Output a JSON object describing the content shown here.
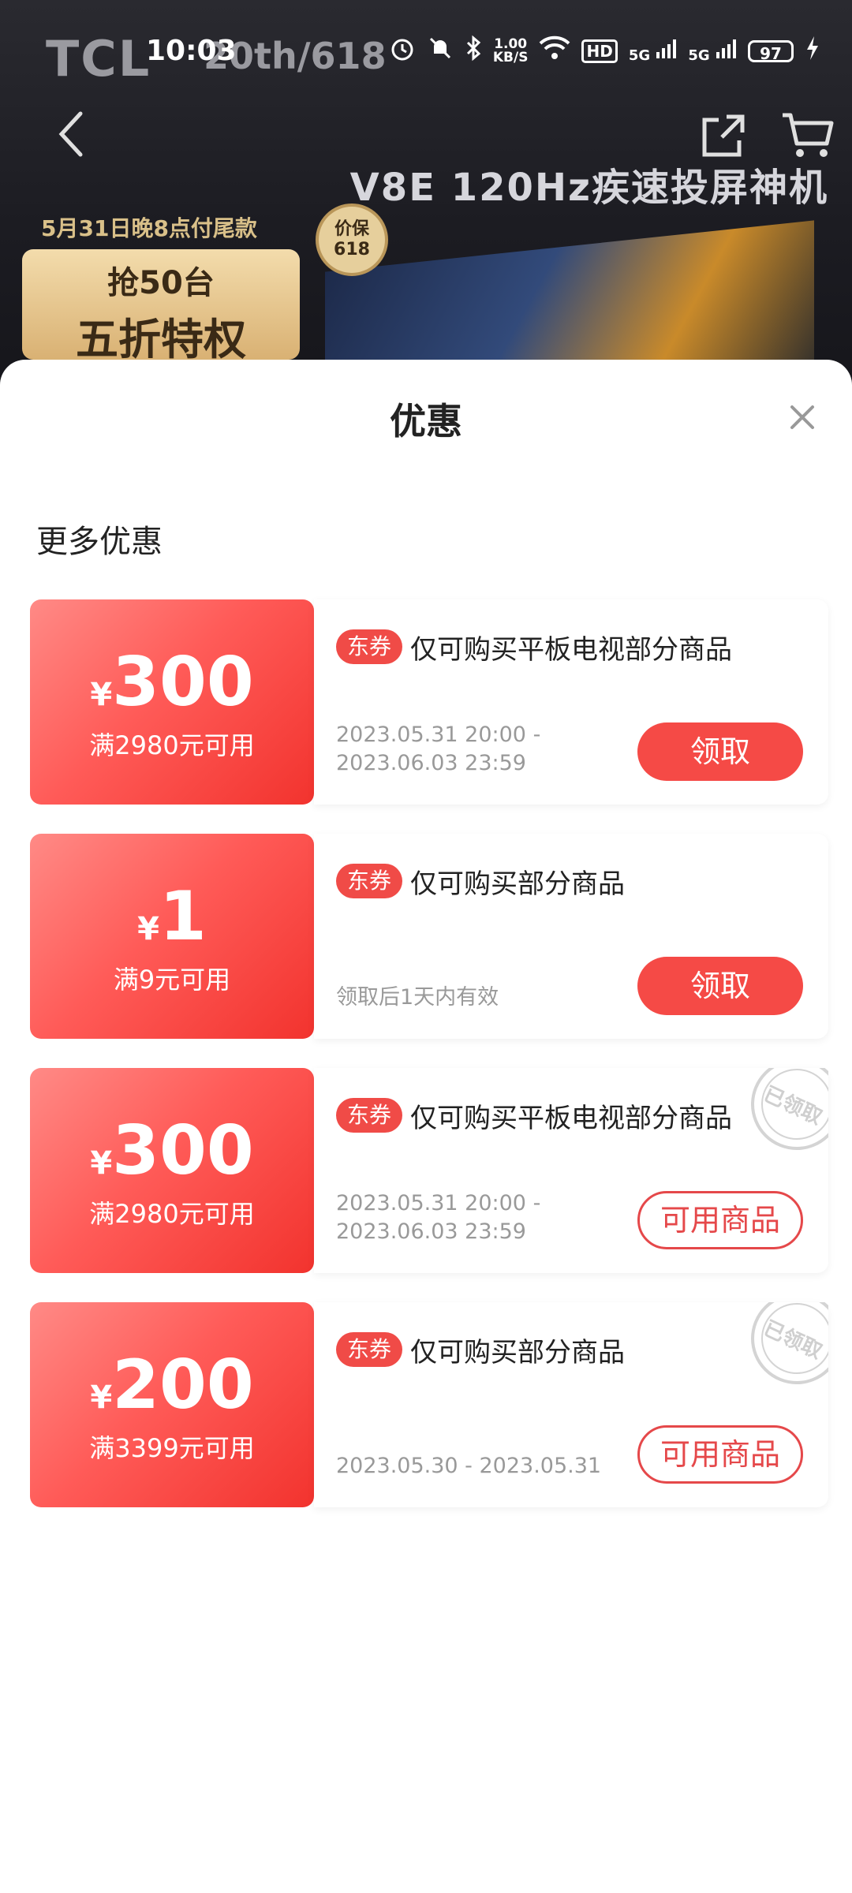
{
  "status_bar": {
    "time": "10:03",
    "speed_value": "1.00",
    "speed_unit": "KB/S",
    "hd_label": "HD",
    "net1": "5G",
    "net2": "5G",
    "battery": "97"
  },
  "banner": {
    "brand": "TCL",
    "brand_event": "20th/618",
    "product_title": "V8E 120Hz疾速投屏神机",
    "date_line": "5月31日晚8点付尾款",
    "badge_line1": "抢50台",
    "badge_line2": "五折特权",
    "price_protect": "价保 618"
  },
  "sheet": {
    "title": "优惠",
    "section_title": "更多优惠"
  },
  "coupons": [
    {
      "currency": "¥",
      "amount": "300",
      "condition": "满2980元可用",
      "tag": "东券",
      "description": "仅可购买平板电视部分商品",
      "validity_line1": "2023.05.31 20:00 -",
      "validity_line2": "2023.06.03 23:59",
      "button": "领取",
      "claimed": false
    },
    {
      "currency": "¥",
      "amount": "1",
      "condition": "满9元可用",
      "tag": "东券",
      "description": "仅可购买部分商品",
      "validity_line1": "领取后1天内有效",
      "validity_line2": "",
      "button": "领取",
      "claimed": false
    },
    {
      "currency": "¥",
      "amount": "300",
      "condition": "满2980元可用",
      "tag": "东券",
      "description": "仅可购买平板电视部分商品",
      "validity_line1": "2023.05.31 20:00 -",
      "validity_line2": "2023.06.03 23:59",
      "button": "可用商品",
      "claimed": true,
      "stamp": "已领取"
    },
    {
      "currency": "¥",
      "amount": "200",
      "condition": "满3399元可用",
      "tag": "东券",
      "description": "仅可购买部分商品",
      "validity_line1": "2023.05.30 - 2023.05.31",
      "validity_line2": "",
      "button": "可用商品",
      "claimed": true,
      "stamp": "已领取"
    }
  ],
  "colors": {
    "accent": "#f54a46",
    "coupon_gradient_start": "#ff8a86",
    "coupon_gradient_end": "#f2332e",
    "muted_text": "#999999"
  }
}
